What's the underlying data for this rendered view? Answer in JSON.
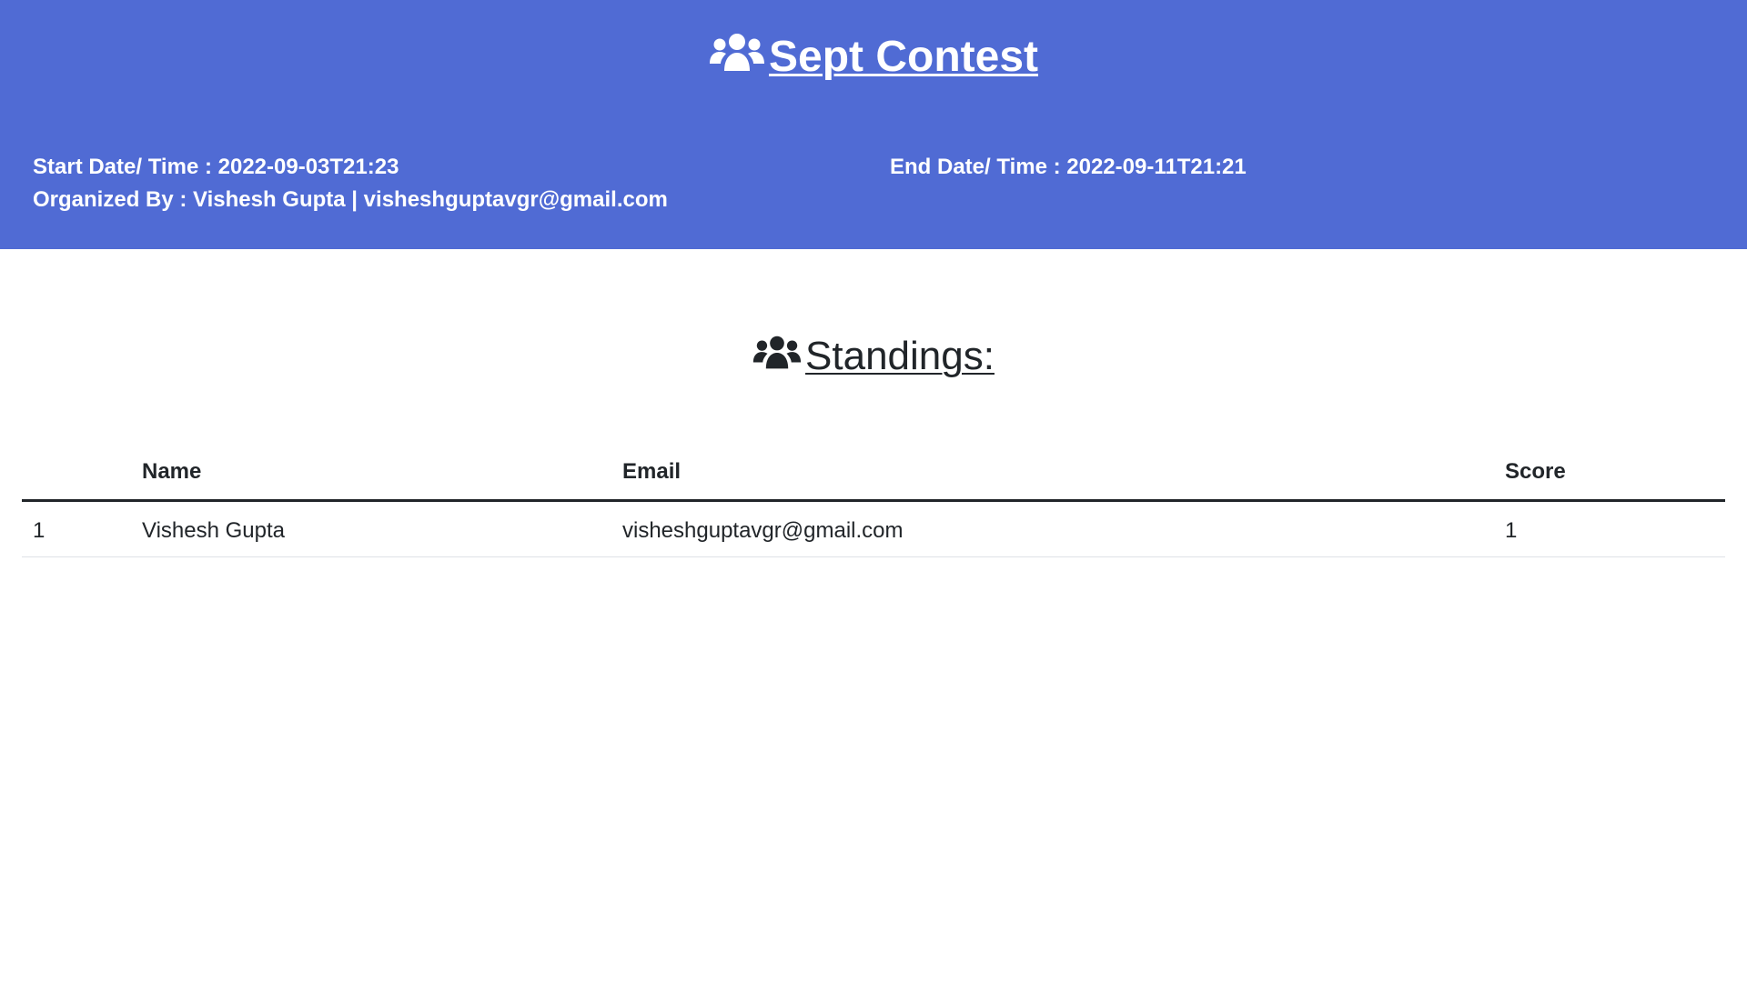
{
  "header": {
    "title": "Sept Contest",
    "icon": "users-icon",
    "start_label": "Start Date/ Time : ",
    "start_value": "2022-09-03T21:23",
    "end_label": "End Date/ Time : ",
    "end_value": "2022-09-11T21:21",
    "organized_label": "Organized By : ",
    "organizer": "Vishesh Gupta | visheshguptavgr@gmail.com",
    "background_color": "#506bd4"
  },
  "standings": {
    "title": "Standings:",
    "icon": "users-icon",
    "columns": [
      "",
      "Name",
      "Email",
      "Score"
    ],
    "rows": [
      {
        "rank": "1",
        "name": "Vishesh Gupta",
        "email": "visheshguptavgr@gmail.com",
        "score": "1"
      }
    ]
  }
}
